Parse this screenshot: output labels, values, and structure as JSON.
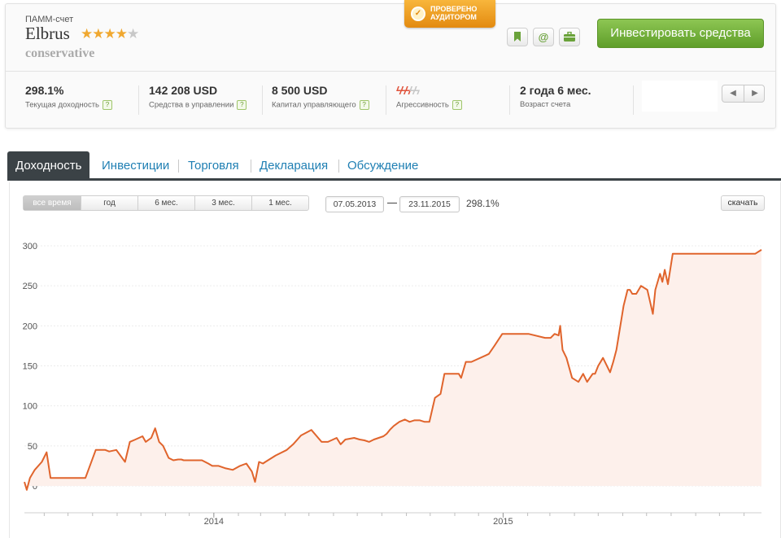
{
  "header": {
    "account_type": "ПАММ-счет",
    "account_name": "Elbrus",
    "rating_stars": "★★★★",
    "rating_half_star": "★",
    "strategy": "conservative",
    "badge_line1": "ПРОВЕРЕНО",
    "badge_line2": "АУДИТОРОМ",
    "invest_button": "Инвестировать средства",
    "icon_buttons": [
      "bookmark-icon",
      "email-icon",
      "briefcase-icon"
    ]
  },
  "stats": [
    {
      "value": "298.1%",
      "label": "Текущая доходность"
    },
    {
      "value": "142 208 USD",
      "label": "Средства в управлении"
    },
    {
      "value": "8 500 USD",
      "label": "Капитал управляющего"
    },
    {
      "value": "",
      "label": "Агрессивность",
      "bolts_on": 3,
      "bolts_total": 5
    },
    {
      "value": "2 года 6 мес.",
      "label": "Возраст счета"
    }
  ],
  "tabs": [
    "Доходность",
    "Инвестиции",
    "Торговля",
    "Декларация",
    "Обсуждение"
  ],
  "active_tab": 0,
  "controls": {
    "ranges": [
      "все время",
      "год",
      "6 мес.",
      "3 мес.",
      "1 мес."
    ],
    "active_range": 0,
    "date_from": "07.05.2013",
    "date_to": "23.11.2015",
    "range_return": "298.1%",
    "download": "скачать"
  },
  "colors": {
    "line": "#e0642c",
    "area": "#fdf0eb",
    "invest_button": "#6fae38",
    "badge": "#f0a020",
    "tab_active": "#3b4246",
    "tab_link": "#1f7fb3"
  },
  "chart_data": {
    "type": "area",
    "title": "",
    "xlabel": "",
    "ylabel": "",
    "ylim": [
      0,
      300
    ],
    "y_ticks": [
      0,
      50,
      100,
      150,
      200,
      250,
      300
    ],
    "x_tick_labels": [
      {
        "label": "2014",
        "date": "2014-01-01"
      },
      {
        "label": "2015",
        "date": "2015-01-01"
      }
    ],
    "grid": true,
    "legend": "none",
    "series": [
      {
        "x": [
          "2013-05-07",
          "2013-05-10",
          "2013-05-14",
          "2013-05-20",
          "2013-05-29",
          "2013-06-04",
          "2013-06-09",
          "2013-06-15",
          "2013-06-20",
          "2013-06-25",
          "2013-06-28",
          "2013-07-04",
          "2013-07-14",
          "2013-07-23",
          "2013-08-05",
          "2013-08-13",
          "2013-08-17",
          "2013-08-22",
          "2013-08-31",
          "2013-09-11",
          "2013-09-17",
          "2013-09-24",
          "2013-10-03",
          "2013-10-07",
          "2013-10-14",
          "2013-10-19",
          "2013-10-24",
          "2013-10-29",
          "2013-11-05",
          "2013-11-11",
          "2013-11-17",
          "2013-11-21",
          "2013-11-24",
          "2013-12-03",
          "2013-12-12",
          "2013-12-17",
          "2013-12-25",
          "2013-12-30",
          "2014-01-07",
          "2014-01-16",
          "2014-01-25",
          "2014-02-03",
          "2014-02-11",
          "2014-02-18",
          "2014-02-22",
          "2014-02-27",
          "2014-03-04",
          "2014-03-07",
          "2014-03-20",
          "2014-04-03",
          "2014-04-11",
          "2014-04-21",
          "2014-05-04",
          "2014-05-17",
          "2014-05-25",
          "2014-06-05",
          "2014-06-10",
          "2014-06-16",
          "2014-06-27",
          "2014-07-04",
          "2014-07-10",
          "2014-07-16",
          "2014-07-22",
          "2014-08-03",
          "2014-08-07",
          "2014-08-11",
          "2014-08-16",
          "2014-08-23",
          "2014-08-30",
          "2014-09-05",
          "2014-09-11",
          "2014-09-18",
          "2014-09-24",
          "2014-09-27",
          "2014-09-30",
          "2014-10-07",
          "2014-10-14",
          "2014-10-19",
          "2014-10-28",
          "2014-11-06",
          "2014-11-09",
          "2014-11-15",
          "2014-11-22",
          "2014-12-10",
          "2014-12-14",
          "2014-12-21",
          "2014-12-31",
          "2015-01-11",
          "2015-01-19",
          "2015-02-02",
          "2015-02-23",
          "2015-03-02",
          "2015-03-07",
          "2015-03-12",
          "2015-03-14",
          "2015-03-17",
          "2015-03-22",
          "2015-03-29",
          "2015-04-06",
          "2015-04-12",
          "2015-04-17",
          "2015-04-24",
          "2015-04-27",
          "2015-05-01",
          "2015-05-07",
          "2015-05-16",
          "2015-05-20",
          "2015-05-24",
          "2015-06-02",
          "2015-06-07",
          "2015-06-10",
          "2015-06-13",
          "2015-06-18",
          "2015-06-24",
          "2015-07-02",
          "2015-07-09",
          "2015-07-12",
          "2015-07-18",
          "2015-07-21",
          "2015-07-24",
          "2015-07-28",
          "2015-08-03",
          "2015-08-13",
          "2015-09-02",
          "2015-10-02",
          "2015-11-02",
          "2015-11-15",
          "2015-11-23"
        ],
        "y": [
          5,
          -5,
          10,
          20,
          30,
          42,
          10,
          10,
          10,
          10,
          10,
          10,
          10,
          10,
          45,
          45,
          45,
          43,
          45,
          30,
          55,
          58,
          62,
          55,
          60,
          72,
          55,
          50,
          35,
          32,
          33,
          33,
          32,
          32,
          32,
          32,
          28,
          25,
          25,
          22,
          20,
          25,
          28,
          18,
          5,
          30,
          28,
          30,
          38,
          45,
          52,
          63,
          70,
          55,
          55,
          60,
          52,
          58,
          60,
          58,
          57,
          55,
          58,
          62,
          65,
          70,
          75,
          80,
          83,
          80,
          82,
          82,
          80,
          80,
          80,
          110,
          115,
          140,
          140,
          140,
          135,
          155,
          155,
          163,
          165,
          175,
          190,
          190,
          190,
          190,
          185,
          185,
          190,
          188,
          200,
          170,
          160,
          135,
          130,
          140,
          130,
          140,
          140,
          150,
          160,
          142,
          155,
          170,
          225,
          245,
          245,
          240,
          240,
          250,
          245,
          215,
          245,
          265,
          255,
          270,
          252,
          290,
          290,
          290,
          290,
          290,
          290,
          295
        ]
      }
    ]
  }
}
